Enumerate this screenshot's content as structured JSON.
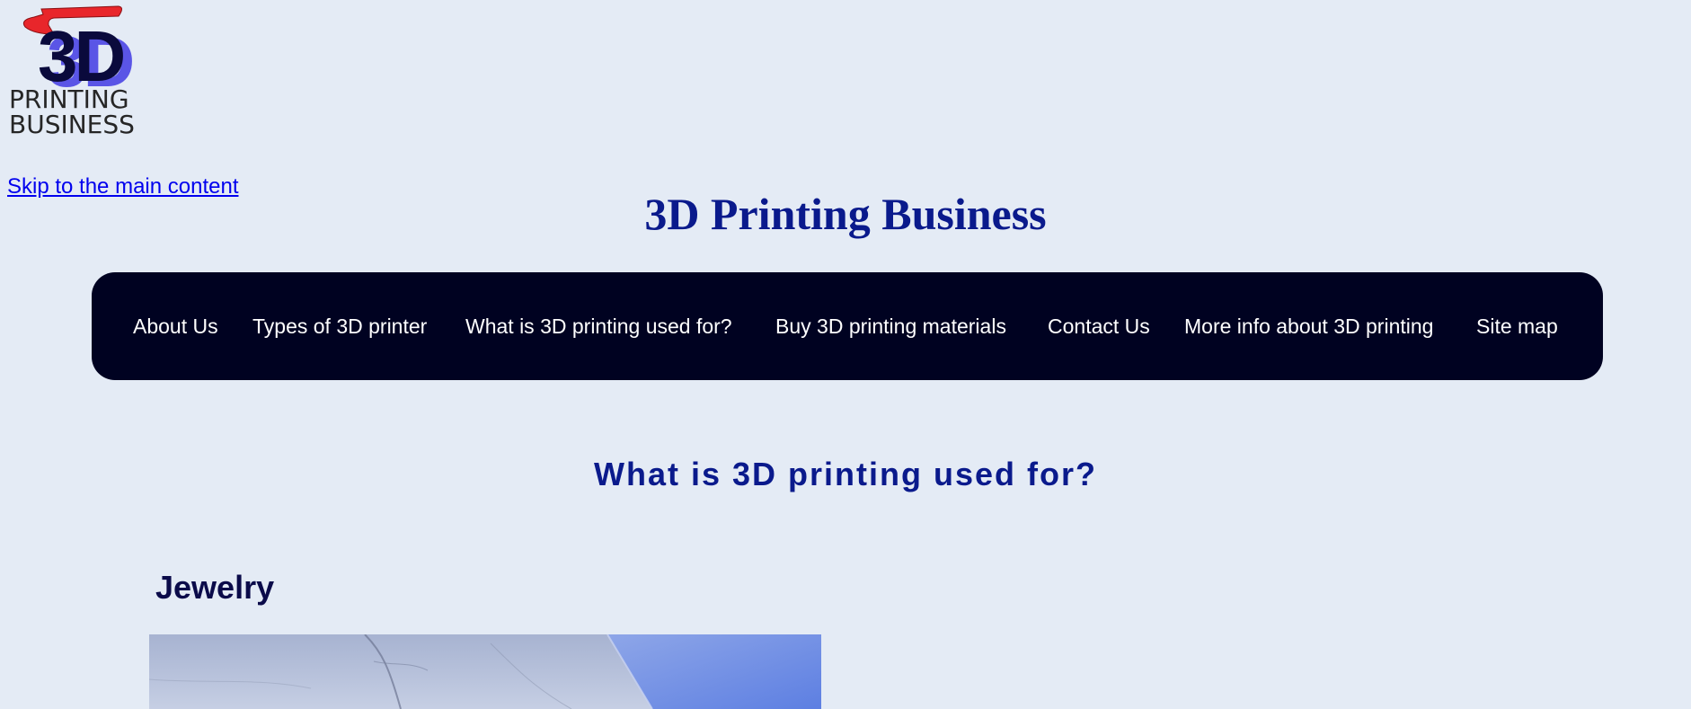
{
  "logo": {
    "big_text": "3D",
    "line1": "PRINTING",
    "line2": "BUSINESS"
  },
  "skip_link": "Skip to the main content",
  "site_title": "3D Printing Business",
  "nav": {
    "items": [
      {
        "label": "About Us"
      },
      {
        "label": "Types of 3D printer"
      },
      {
        "label": "What is 3D printing used for?"
      },
      {
        "label": "Buy 3D printing materials"
      },
      {
        "label": "Contact Us"
      },
      {
        "label": "More info about 3D printing"
      },
      {
        "label": "Site map"
      }
    ]
  },
  "main": {
    "heading": "What is 3D printing used for?",
    "sections": [
      {
        "title": "Jewelry"
      }
    ]
  },
  "colors": {
    "page_background": "#e4ebf5",
    "nav_background": "#000221",
    "title_blue": "#0a1a8c",
    "section_heading": "#0b0b4a",
    "link": "#0000ee",
    "logo_red": "#e8262b",
    "logo_navy": "#0a0a3c",
    "logo_violet": "#5a55e6"
  }
}
